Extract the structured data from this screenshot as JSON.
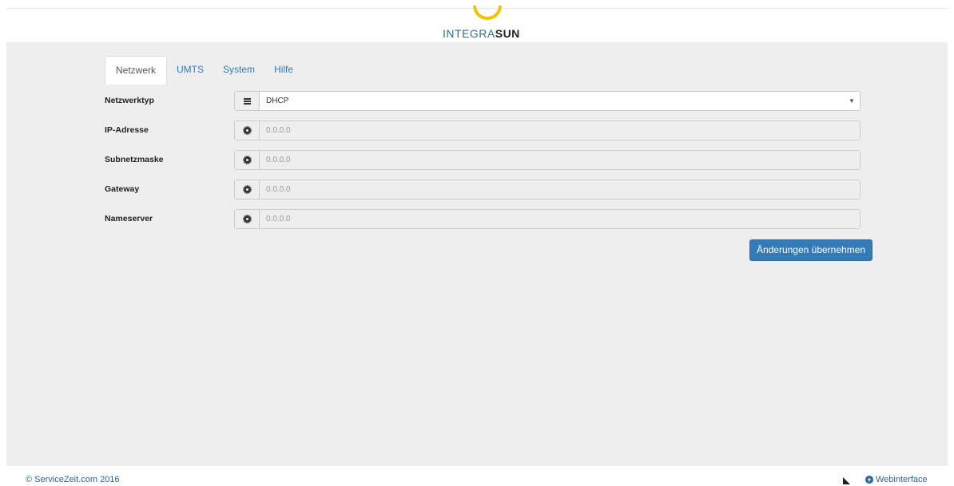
{
  "brand": {
    "part1": "INTEGRA",
    "part2": "SUN",
    "arc_color": "#f5c200"
  },
  "tabs": [
    {
      "label": "Netzwerk",
      "active": true
    },
    {
      "label": "UMTS",
      "active": false
    },
    {
      "label": "System",
      "active": false
    },
    {
      "label": "Hilfe",
      "active": false
    }
  ],
  "form": {
    "network_type": {
      "label": "Netzwerktyp",
      "value": "DHCP",
      "icon": "list-icon",
      "caret": "▼"
    },
    "ip_address": {
      "label": "IP-Adresse",
      "placeholder": "0.0.0.0",
      "icon": "gear-icon"
    },
    "subnet_mask": {
      "label": "Subnetzmaske",
      "placeholder": "0.0.0.0",
      "icon": "gear-icon"
    },
    "gateway": {
      "label": "Gateway",
      "placeholder": "0.0.0.0",
      "icon": "gear-icon"
    },
    "nameserver": {
      "label": "Nameserver",
      "placeholder": "0.0.0.0",
      "icon": "gear-icon"
    }
  },
  "apply_button": {
    "label": "Änderungen übernehmen",
    "color": "#337ab7"
  },
  "footer": {
    "copyright": "© ServiceZeit.com 2016",
    "webinterface": "Webinterface",
    "link_icon": "plus-circle-icon"
  }
}
